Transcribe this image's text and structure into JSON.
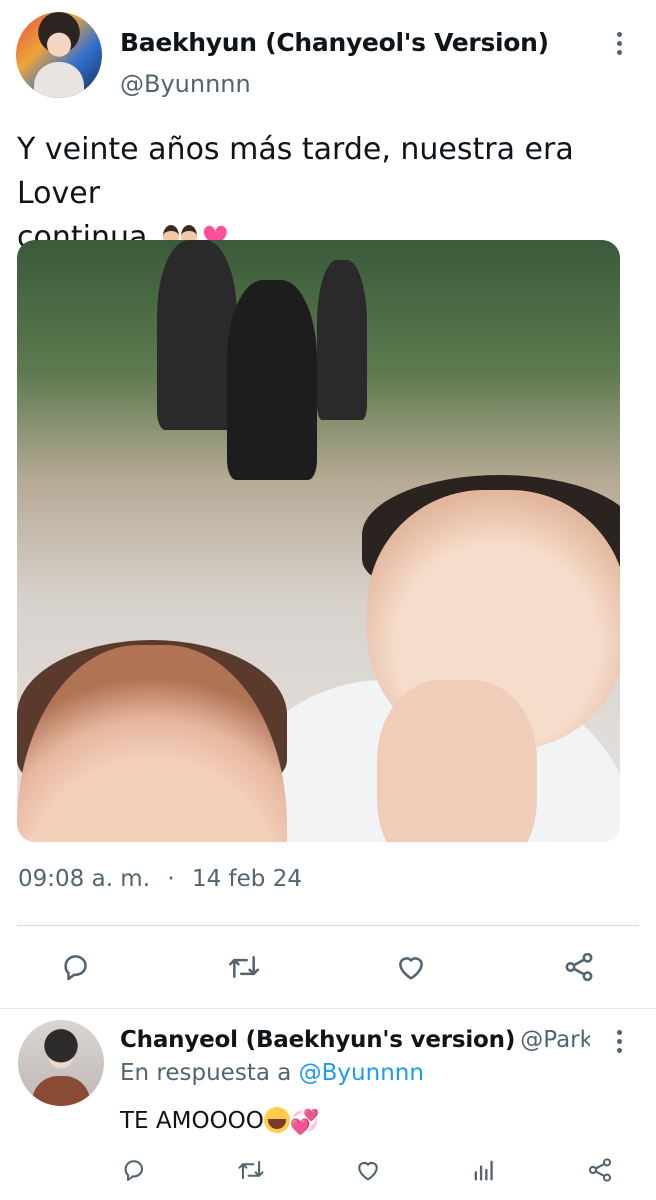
{
  "tweet": {
    "display_name": "Baekhyun (Chanyeol's Version)",
    "handle": "@Byunnnn",
    "text_line1": "Y veinte años más tarde, nuestra era Lover",
    "text_line2": "continua",
    "time": "09:08 a. m.",
    "separator": "·",
    "date": "14 feb 24"
  },
  "actions": {
    "reply": "reply-icon",
    "retweet": "retweet-icon",
    "like": "heart-icon",
    "share": "share-icon"
  },
  "reply": {
    "display_name": "Chanyeol (Baekhyun's version)",
    "handle": "@Park...",
    "replying_prefix": "En respuesta a",
    "replying_to": "@Byunnnn",
    "text": "TE AMOOOO"
  },
  "colors": {
    "accent": "#1d9bf0",
    "secondary_text": "#536471",
    "divider": "#cfd9de"
  }
}
